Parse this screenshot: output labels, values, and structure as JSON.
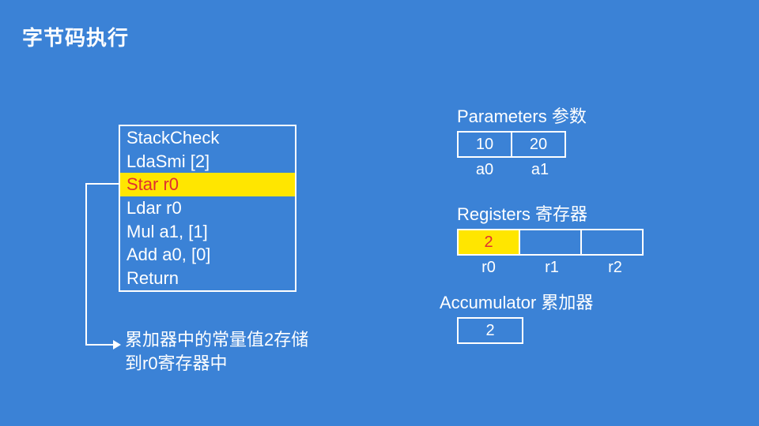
{
  "title": "字节码执行",
  "bytecode": {
    "lines": [
      "StackCheck",
      "LdaSmi [2]",
      "Star r0",
      "Ldar r0",
      "Mul a1, [1]",
      "Add a0, [0]",
      "Return"
    ],
    "highlight_index": 2
  },
  "annotation": {
    "line1": "累加器中的常量值2存储",
    "line2": "到r0寄存器中"
  },
  "parameters": {
    "label": "Parameters 参数",
    "cells": [
      "10",
      "20"
    ],
    "names": [
      "a0",
      "a1"
    ]
  },
  "registers": {
    "label": "Registers 寄存器",
    "cells": [
      "2",
      "",
      ""
    ],
    "highlight_index": 0,
    "names": [
      "r0",
      "r1",
      "r2"
    ]
  },
  "accumulator": {
    "label": "Accumulator 累加器",
    "value": "2"
  }
}
